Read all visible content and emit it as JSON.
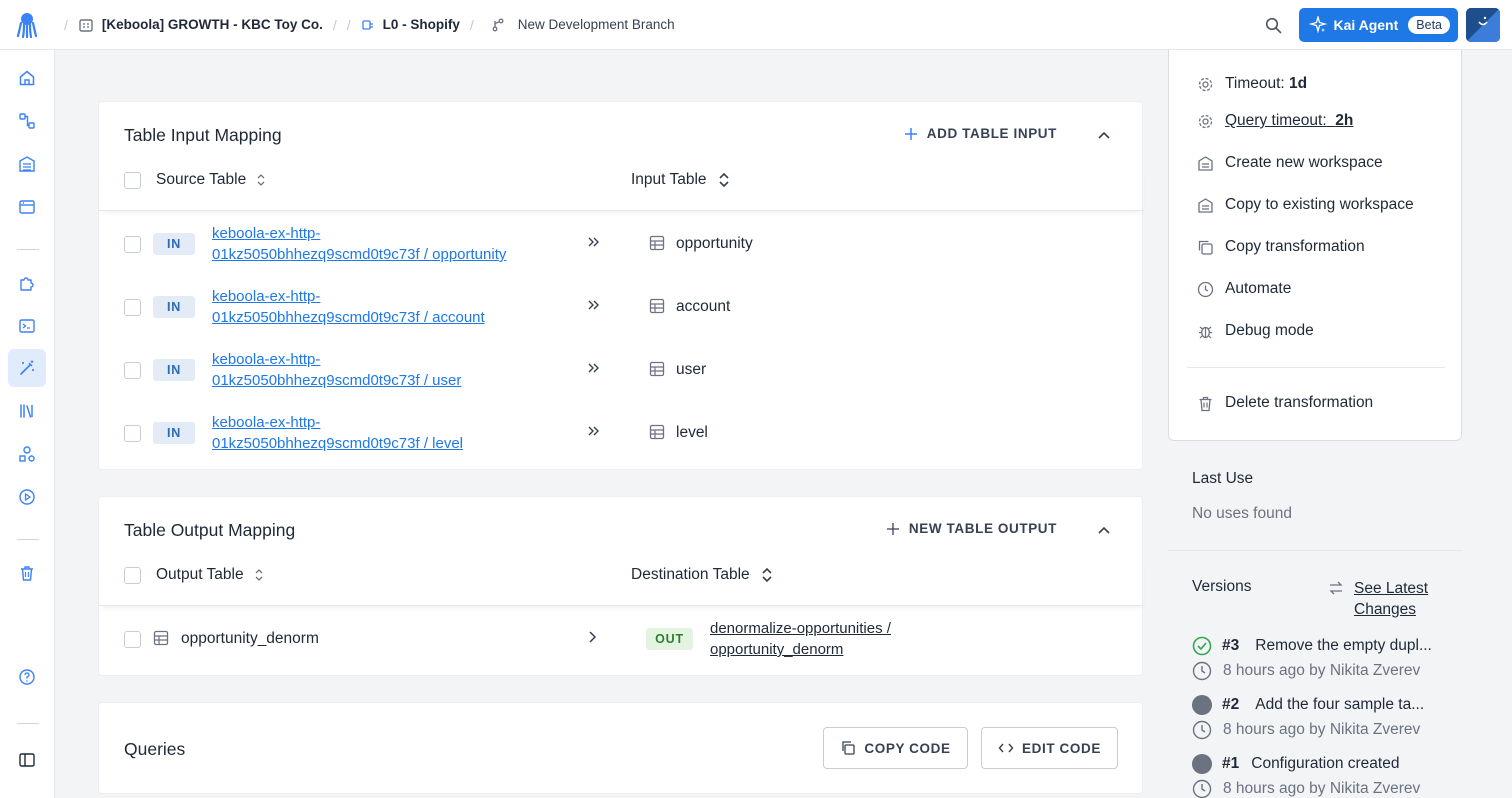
{
  "header": {
    "breadcrumbs": [
      {
        "label": "[Keboola] GROWTH - KBC Toy Co.",
        "icon": "building-icon"
      },
      {
        "label": "L0 - Shopify",
        "icon": "config-icon"
      },
      {
        "label": "New Development Branch",
        "icon": "branch-icon"
      }
    ],
    "kai_label": "Kai Agent",
    "kai_badge": "Beta"
  },
  "input_mapping": {
    "title": "Table Input Mapping",
    "add_label": "ADD TABLE INPUT",
    "col_source": "Source Table",
    "col_input": "Input Table",
    "rows": [
      {
        "badge": "IN",
        "source_line1": "keboola-ex-http-",
        "source_line2": "01kz5050bhhezq9scmd0t9c73f / opportunity",
        "target": "opportunity"
      },
      {
        "badge": "IN",
        "source_line1": "keboola-ex-http-",
        "source_line2": "01kz5050bhhezq9scmd0t9c73f / account",
        "target": "account"
      },
      {
        "badge": "IN",
        "source_line1": "keboola-ex-http-",
        "source_line2": "01kz5050bhhezq9scmd0t9c73f / user",
        "target": "user"
      },
      {
        "badge": "IN",
        "source_line1": "keboola-ex-http-",
        "source_line2": "01kz5050bhhezq9scmd0t9c73f / level",
        "target": "level"
      }
    ]
  },
  "output_mapping": {
    "title": "Table Output Mapping",
    "add_label": "NEW TABLE OUTPUT",
    "col_output": "Output Table",
    "col_destination": "Destination Table",
    "rows": [
      {
        "source": "opportunity_denorm",
        "badge": "OUT",
        "dest_line1": "denormalize-opportunities /",
        "dest_line2": "opportunity_denorm"
      }
    ]
  },
  "queries": {
    "title": "Queries",
    "copy_label": "COPY CODE",
    "edit_label": "EDIT CODE"
  },
  "actions": {
    "timeout_label": "Timeout:",
    "timeout_value": "1d",
    "query_timeout_label": "Query timeout:",
    "query_timeout_value": "2h",
    "items": [
      "Create new workspace",
      "Copy to existing workspace",
      "Copy transformation",
      "Automate",
      "Debug mode"
    ],
    "delete_label": "Delete transformation"
  },
  "last_use": {
    "title": "Last Use",
    "value": "No uses found"
  },
  "versions": {
    "title": "Versions",
    "see_latest_line1": "See Latest",
    "see_latest_line2": "Changes",
    "items": [
      {
        "num": "#3",
        "desc": "Remove the empty dupl...",
        "meta": "8 hours ago by Nikita Zverev",
        "status": "current"
      },
      {
        "num": "#2",
        "desc": "Add the four sample ta...",
        "meta": "8 hours ago by Nikita Zverev",
        "status": "past"
      },
      {
        "num": "#1",
        "desc": "Configuration created",
        "meta": "8 hours ago by Nikita Zverev",
        "status": "past"
      }
    ]
  },
  "colors": {
    "accent": "#1e78e6",
    "in_badge": "#e3ecf6",
    "out_badge": "#e3f5e1",
    "success": "#34a853"
  }
}
